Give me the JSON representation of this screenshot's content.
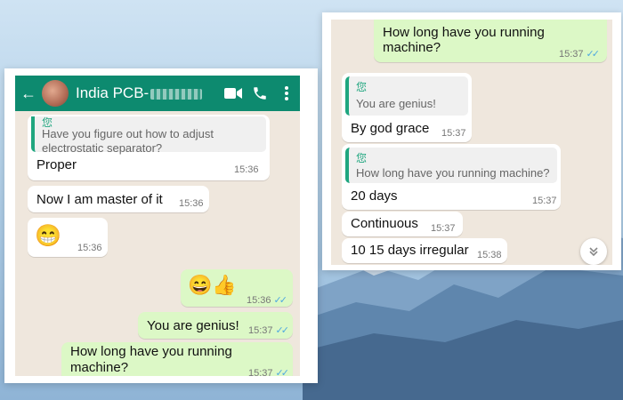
{
  "header": {
    "contact_name": "India PCB-",
    "back_icon": "arrow-back-icon",
    "video_icon": "video-call-icon",
    "call_icon": "phone-icon",
    "menu_icon": "more-vertical-icon",
    "color": "#0d8a6f"
  },
  "left_chat": {
    "quoted_top": {
      "sender": "您",
      "text_line1": "Have you figure out how to adjust",
      "text_line2": "electrostatic separator?"
    },
    "messages": [
      {
        "text": "Proper",
        "time": "15:36"
      },
      {
        "text": "Now I am master of it",
        "time": "15:36"
      },
      {
        "text": "😁",
        "time": "15:36"
      },
      {
        "text": "😄👍",
        "time": "15:36"
      },
      {
        "text": "You are genius!",
        "time": "15:37"
      },
      {
        "text_line1": "How long have you running",
        "text_line2": "machine?",
        "time": "15:37"
      }
    ]
  },
  "right_chat": {
    "messages": [
      {
        "text_line1": "How long have you running",
        "text_line2": "machine?",
        "time": "15:37"
      },
      {
        "quote_sender": "您",
        "quote_text": "You are genius!",
        "text": "By god grace",
        "time": "15:37"
      },
      {
        "quote_sender": "您",
        "quote_text": "How long have you running machine?",
        "text": "20 days",
        "time": "15:37"
      },
      {
        "text": "Continuous",
        "time": "15:37"
      },
      {
        "text": "10 15 days irregular",
        "time": "15:38"
      }
    ],
    "scroll_icon": "double-chevron-down-icon"
  },
  "colors": {
    "incoming_bubble": "#ffffff",
    "outgoing_bubble": "#dcf8c6",
    "chat_background": "#efe7dd",
    "read_ticks": "#4fa9e0",
    "quote_accent": "#1fa67f"
  }
}
